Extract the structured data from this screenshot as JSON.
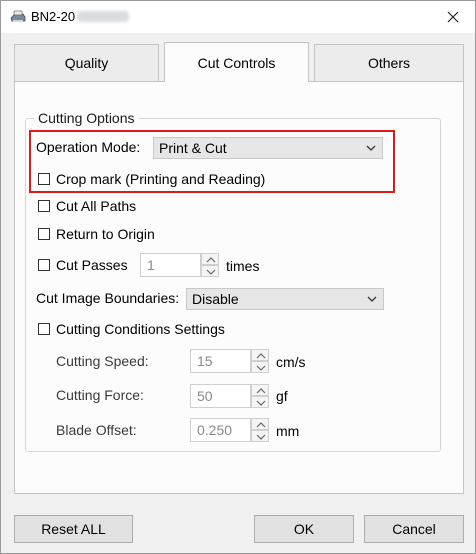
{
  "window": {
    "title": "BN2-20",
    "title_icon": "printer-icon"
  },
  "tabs": [
    {
      "label": "Quality",
      "active": false
    },
    {
      "label": "Cut Controls",
      "active": true
    },
    {
      "label": "Others",
      "active": false
    }
  ],
  "cutting_options": {
    "group_title": "Cutting Options",
    "operation_mode_label": "Operation Mode:",
    "operation_mode_value": "Print & Cut",
    "crop_mark_label": "Crop mark (Printing and Reading)",
    "crop_mark_checked": false,
    "cut_all_paths_label": "Cut All Paths",
    "cut_all_paths_checked": false,
    "return_to_origin_label": "Return to Origin",
    "return_to_origin_checked": false,
    "cut_passes_label": "Cut Passes",
    "cut_passes_checked": false,
    "cut_passes_value": "1",
    "cut_passes_unit": "times",
    "cut_image_boundaries_label": "Cut Image Boundaries:",
    "cut_image_boundaries_value": "Disable",
    "cutting_conditions_label": "Cutting Conditions Settings",
    "cutting_conditions_checked": false,
    "cutting_speed_label": "Cutting Speed:",
    "cutting_speed_value": "15",
    "cutting_speed_unit": "cm/s",
    "cutting_force_label": "Cutting Force:",
    "cutting_force_value": "50",
    "cutting_force_unit": "gf",
    "blade_offset_label": "Blade Offset:",
    "blade_offset_value": "0.250",
    "blade_offset_unit": "mm"
  },
  "buttons": {
    "reset_all": "Reset ALL",
    "ok": "OK",
    "cancel": "Cancel"
  },
  "colors": {
    "highlight": "#e01a1a",
    "background": "#f0f0f0",
    "panel": "#fcfcfc"
  }
}
